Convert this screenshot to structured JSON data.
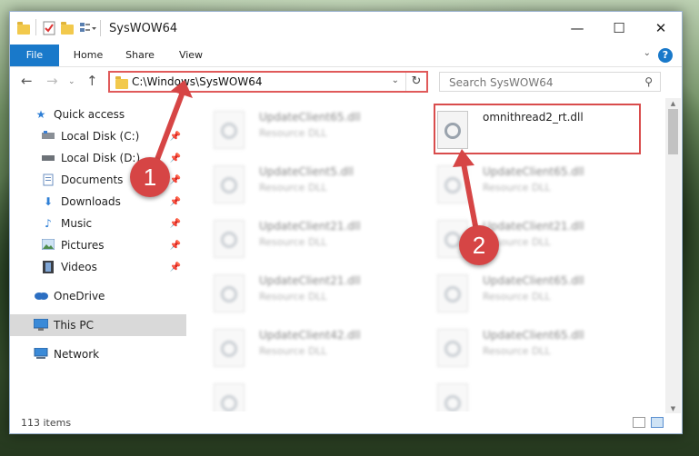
{
  "window": {
    "title": "SysWOW64",
    "controls": {
      "minimize": "—",
      "maximize": "☐",
      "close": "✕"
    }
  },
  "ribbon": {
    "tabs": [
      "File",
      "Home",
      "Share",
      "View"
    ],
    "help": "?"
  },
  "navigation": {
    "back": "←",
    "forward": "→",
    "up": "↑",
    "address": "C:\\Windows\\SysWOW64",
    "search_placeholder": "Search SysWOW64"
  },
  "sidebar": {
    "items": [
      {
        "label": "Quick access",
        "icon": "star-icon"
      },
      {
        "label": "Local Disk (C:)",
        "icon": "drive-icon"
      },
      {
        "label": "Local Disk (D:)",
        "icon": "drive-icon"
      },
      {
        "label": "Documents",
        "icon": "documents-icon"
      },
      {
        "label": "Downloads",
        "icon": "download-icon"
      },
      {
        "label": "Music",
        "icon": "music-icon"
      },
      {
        "label": "Pictures",
        "icon": "pictures-icon"
      },
      {
        "label": "Videos",
        "icon": "videos-icon"
      },
      {
        "label": "OneDrive",
        "icon": "cloud-icon"
      },
      {
        "label": "This PC",
        "icon": "computer-icon"
      },
      {
        "label": "Network",
        "icon": "network-icon"
      }
    ]
  },
  "files": [
    {
      "name": "UpdateClient65.dll",
      "type": "Resource DLL"
    },
    {
      "name": "omnithread2_rt.dll",
      "type": ""
    },
    {
      "name": "UpdateClient5.dll",
      "type": "Resource DLL"
    },
    {
      "name": "UpdateClient65.dll",
      "type": "Resource DLL"
    },
    {
      "name": "UpdateClient21.dll",
      "type": "Resource DLL"
    },
    {
      "name": "UpdateClient21.dll",
      "type": "Resource DLL"
    },
    {
      "name": "UpdateClient21.dll",
      "type": "Resource DLL"
    },
    {
      "name": "UpdateClient65.dll",
      "type": "Resource DLL"
    },
    {
      "name": "UpdateClient42.dll",
      "type": "Resource DLL"
    },
    {
      "name": "UpdateClient65.dll",
      "type": "Resource DLL"
    }
  ],
  "status": {
    "item_count": "113 items"
  },
  "callouts": [
    "1",
    "2"
  ],
  "colors": {
    "accent": "#1979ca",
    "callout": "#d64545"
  }
}
